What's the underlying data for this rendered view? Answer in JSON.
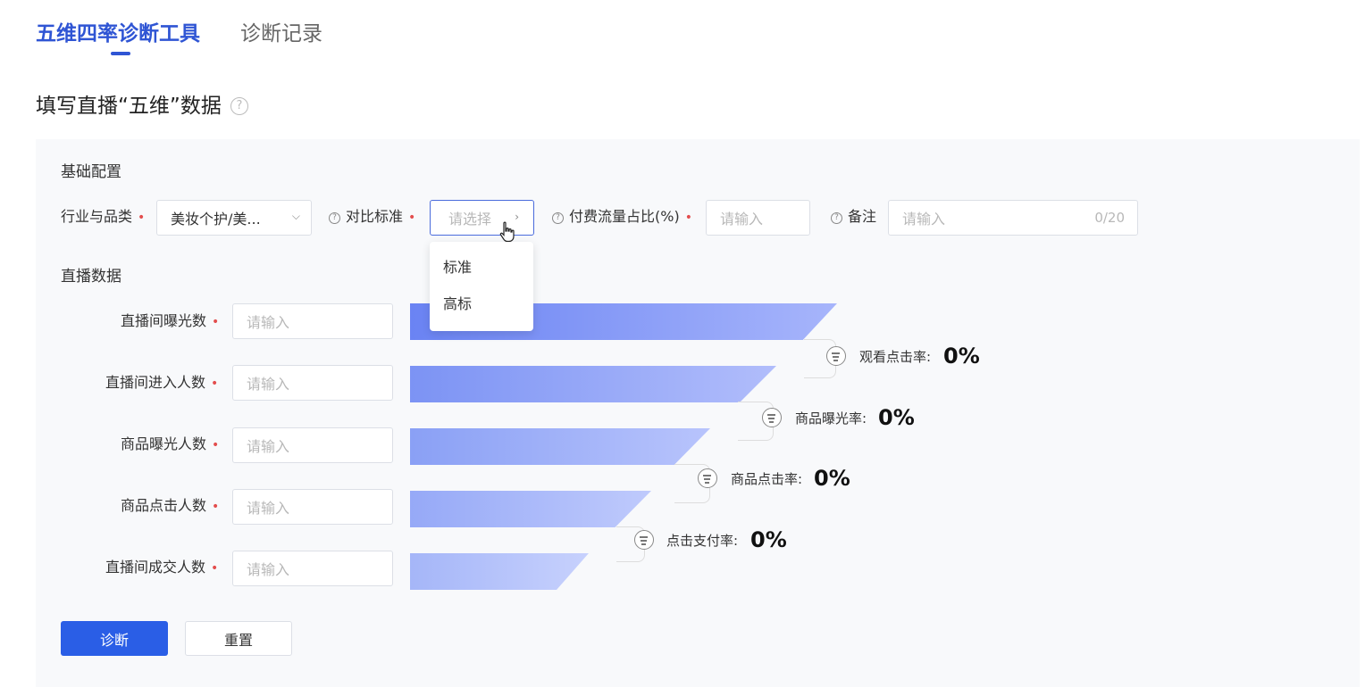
{
  "tabs": [
    {
      "label": "五维四率诊断工具",
      "active": true
    },
    {
      "label": "诊断记录",
      "active": false
    }
  ],
  "page_title": "填写直播“五维”数据",
  "help_glyph": "?",
  "basic_config": {
    "title": "基础配置",
    "industry": {
      "label": "行业与品类",
      "value": "美妆个护/美..."
    },
    "benchmark": {
      "label": "对比标准",
      "placeholder": "请选择",
      "options": [
        "标准",
        "高标"
      ]
    },
    "paid_ratio": {
      "label": "付费流量占比(%)",
      "placeholder": "请输入"
    },
    "remark": {
      "label": "备注",
      "placeholder": "请输入",
      "counter": "0/20"
    }
  },
  "live_data": {
    "title": "直播数据",
    "fields": [
      {
        "label": "直播间曝光数",
        "placeholder": "请输入"
      },
      {
        "label": "直播间进入人数",
        "placeholder": "请输入"
      },
      {
        "label": "商品曝光人数",
        "placeholder": "请输入"
      },
      {
        "label": "商品点击人数",
        "placeholder": "请输入"
      },
      {
        "label": "直播间成交人数",
        "placeholder": "请输入"
      }
    ],
    "rates": [
      {
        "label": "观看点击率:",
        "value": "0%"
      },
      {
        "label": "商品曝光率:",
        "value": "0%"
      },
      {
        "label": "商品点击率:",
        "value": "0%"
      },
      {
        "label": "点击支付率:",
        "value": "0%"
      }
    ]
  },
  "buttons": {
    "diagnose": "诊断",
    "reset": "重置"
  },
  "colors": {
    "primary": "#2a5ee6",
    "tab_active": "#2f55d4",
    "required": "#e34d4d",
    "funnel_start": "#6a83f3",
    "funnel_end": "#c7d1fd"
  }
}
